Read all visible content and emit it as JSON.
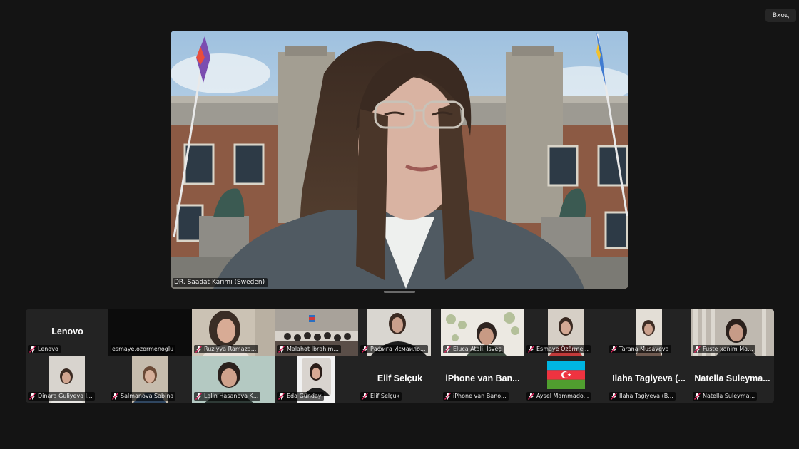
{
  "window": {
    "signin_label": "Вход"
  },
  "speaker": {
    "name": "DR. Saadat Karimi (Sweden)"
  },
  "colors": {
    "muted_mic": "#e0245e",
    "background": "#141414",
    "tile": "#232323"
  },
  "participants": [
    {
      "label": "Lenovo",
      "display_text": "Lenovo",
      "muted": true
    },
    {
      "label": "esmaye.ozormenoglu",
      "muted": false
    },
    {
      "label": "Ruziyya Ramaza...",
      "muted": true
    },
    {
      "label": "Məlahət İbrahim...",
      "muted": true
    },
    {
      "label": "Рафига Исмаило...",
      "muted": true
    },
    {
      "label": "Eluca Atali, İsveç",
      "muted": true
    },
    {
      "label": "Esmaye Özörme...",
      "muted": true
    },
    {
      "label": "Tarana Musayeva",
      "muted": true
    },
    {
      "label": "Fuste xanim Ma...",
      "muted": true
    },
    {
      "label": "Dinara Guliyeva I...",
      "muted": true
    },
    {
      "label": "Salmanova Sabina",
      "muted": true
    },
    {
      "label": "Lalin Hasanova K...",
      "muted": true
    },
    {
      "label": "Eda Günday",
      "muted": true
    },
    {
      "label": "Elif Selçuk",
      "display_text": "Elif Selçuk",
      "muted": true
    },
    {
      "label": "iPhone van Bano...",
      "display_text": "iPhone van Ban...",
      "muted": true
    },
    {
      "label": "Aysel Mammado...",
      "muted": true
    },
    {
      "label": "Ilaha Tagiyeva (B...",
      "display_text": "Ilaha Tagiyeva (...",
      "muted": true
    },
    {
      "label": "Natella Suleyma...",
      "display_text": "Natella Suleyma...",
      "muted": true
    }
  ]
}
